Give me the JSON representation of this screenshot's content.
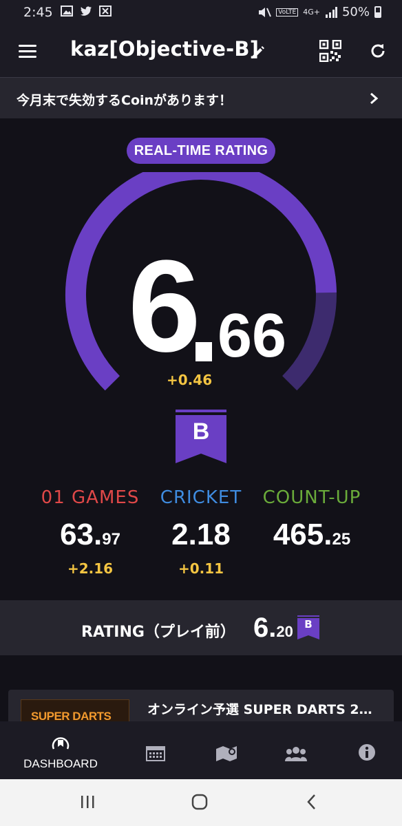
{
  "status_bar": {
    "time": "2:45",
    "network": "4G+",
    "volte": "VoLTE",
    "battery": "50%"
  },
  "app_bar": {
    "title": "kaz[Objective-B]"
  },
  "banner": {
    "text": "今月末で失効するCoinがあります！"
  },
  "rating": {
    "badge": "REAL-TIME RATING",
    "integer": "6",
    "decimal": "66",
    "delta": "+0.46",
    "rank": "B",
    "gauge_fraction": 0.83
  },
  "stats": [
    {
      "label": "01 GAMES",
      "value_int": "63.",
      "value_dec": "97",
      "delta": "+2.16",
      "color": "#e04848"
    },
    {
      "label": "CRICKET",
      "value_int": "2.18",
      "value_dec": "",
      "delta": "+0.11",
      "color": "#3f8ce0"
    },
    {
      "label": "COUNT-UP",
      "value_int": "465.",
      "value_dec": "25",
      "delta": "",
      "color": "#6aab3a"
    }
  ],
  "rating_before": {
    "label": "RATING（プレイ前）",
    "value_int": "6.",
    "value_dec": "20",
    "rank": "B"
  },
  "card": {
    "thumb_text": "SUPER DARTS",
    "title": "オンライン予選 SUPER DARTS 2…"
  },
  "bottom_nav": {
    "dashboard": "DASHBOARD"
  },
  "colors": {
    "accent": "#6a3fc4",
    "gauge_fill": "#6a3fc4",
    "gauge_track": "#3d2b6e",
    "delta": "#f4c542"
  }
}
